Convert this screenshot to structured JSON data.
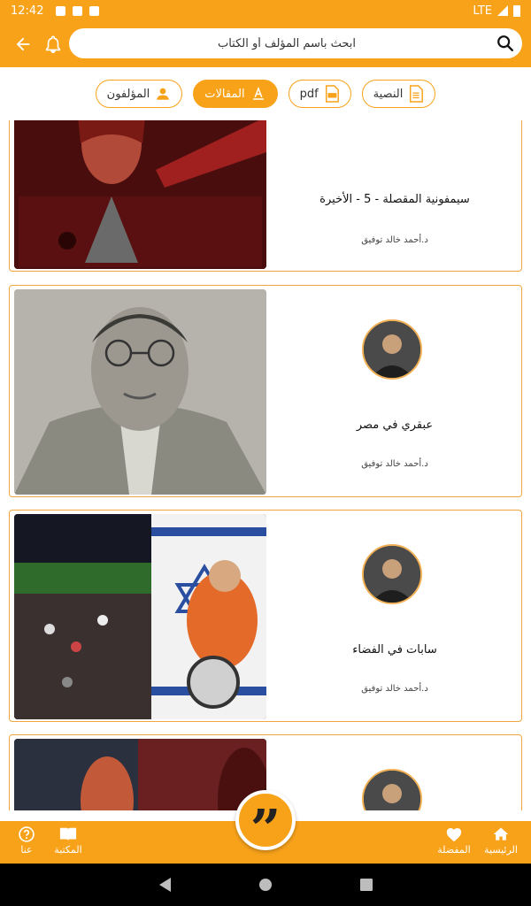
{
  "status_bar": {
    "time": "12:42",
    "network": "LTE"
  },
  "toolbar": {
    "search_placeholder": "ابحث باسم المؤلف أو الكتاب",
    "back_icon": "arrow-back-icon",
    "notification_icon": "bell-icon",
    "search_icon": "search-icon"
  },
  "filters": [
    {
      "label": "النصية",
      "icon": "document-icon",
      "active": false
    },
    {
      "label": "pdf",
      "icon": "pdf-file-icon",
      "active": false
    },
    {
      "label": "المقالات",
      "icon": "text-format-icon",
      "active": true
    },
    {
      "label": "المؤلفون",
      "icon": "person-icon",
      "active": false
    }
  ],
  "articles": [
    {
      "title": "سيمفونية المقصلة - 5 - الأخيرة",
      "author": "د.أحمد خالد توفيق"
    },
    {
      "title": "عبقري في مصر",
      "author": "د.أحمد خالد توفيق"
    },
    {
      "title": "سابات في الفضاء",
      "author": "د.أحمد خالد توفيق"
    },
    {
      "title": "",
      "author": ""
    }
  ],
  "bottom_nav": {
    "home": "الرئيسية",
    "favorites": "المفضلة",
    "library": "المكتبة",
    "about": "عنا"
  },
  "colors": {
    "accent": "#f8a21a",
    "border": "#f1a640"
  }
}
